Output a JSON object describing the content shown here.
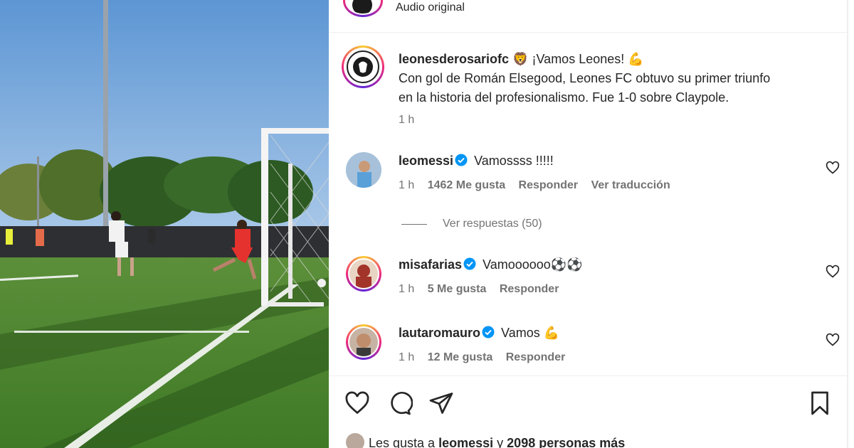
{
  "header": {
    "audio_label": "Audio original"
  },
  "post": {
    "username": "leonesderosariofc",
    "caption_line1": "¡Vamos Leones!",
    "caption_line2": "Con gol de Román Elsegood, Leones FC obtuvo su primer triunfo",
    "caption_line3": "en la historia del profesionalismo. Fue 1-0 sobre Claypole.",
    "emoji_lion": "🦁",
    "emoji_muscle": "💪",
    "time": "1 h"
  },
  "comments": [
    {
      "username": "leomessi",
      "text": "Vamossss !!!!!",
      "time": "1 h",
      "likes": "1462 Me gusta",
      "reply": "Responder",
      "translate": "Ver traducción"
    },
    {
      "username": "misafarias",
      "text": "Vamoooooo⚽⚽",
      "time": "1 h",
      "likes": "5 Me gusta",
      "reply": "Responder"
    },
    {
      "username": "lautaromauro",
      "text": "Vamos 💪",
      "time": "1 h",
      "likes": "12 Me gusta",
      "reply": "Responder"
    }
  ],
  "view_replies": "Ver respuestas (50)",
  "likes_summary": {
    "prefix": "Les gusta a",
    "user": "leomessi",
    "middle": "y",
    "others": "2098 personas más"
  },
  "icons": [
    "heart-icon",
    "comment-icon",
    "share-icon",
    "bookmark-icon",
    "verified-icon"
  ],
  "colors": {
    "verified": "#0095f6",
    "muted": "#737373",
    "text": "#262626"
  }
}
